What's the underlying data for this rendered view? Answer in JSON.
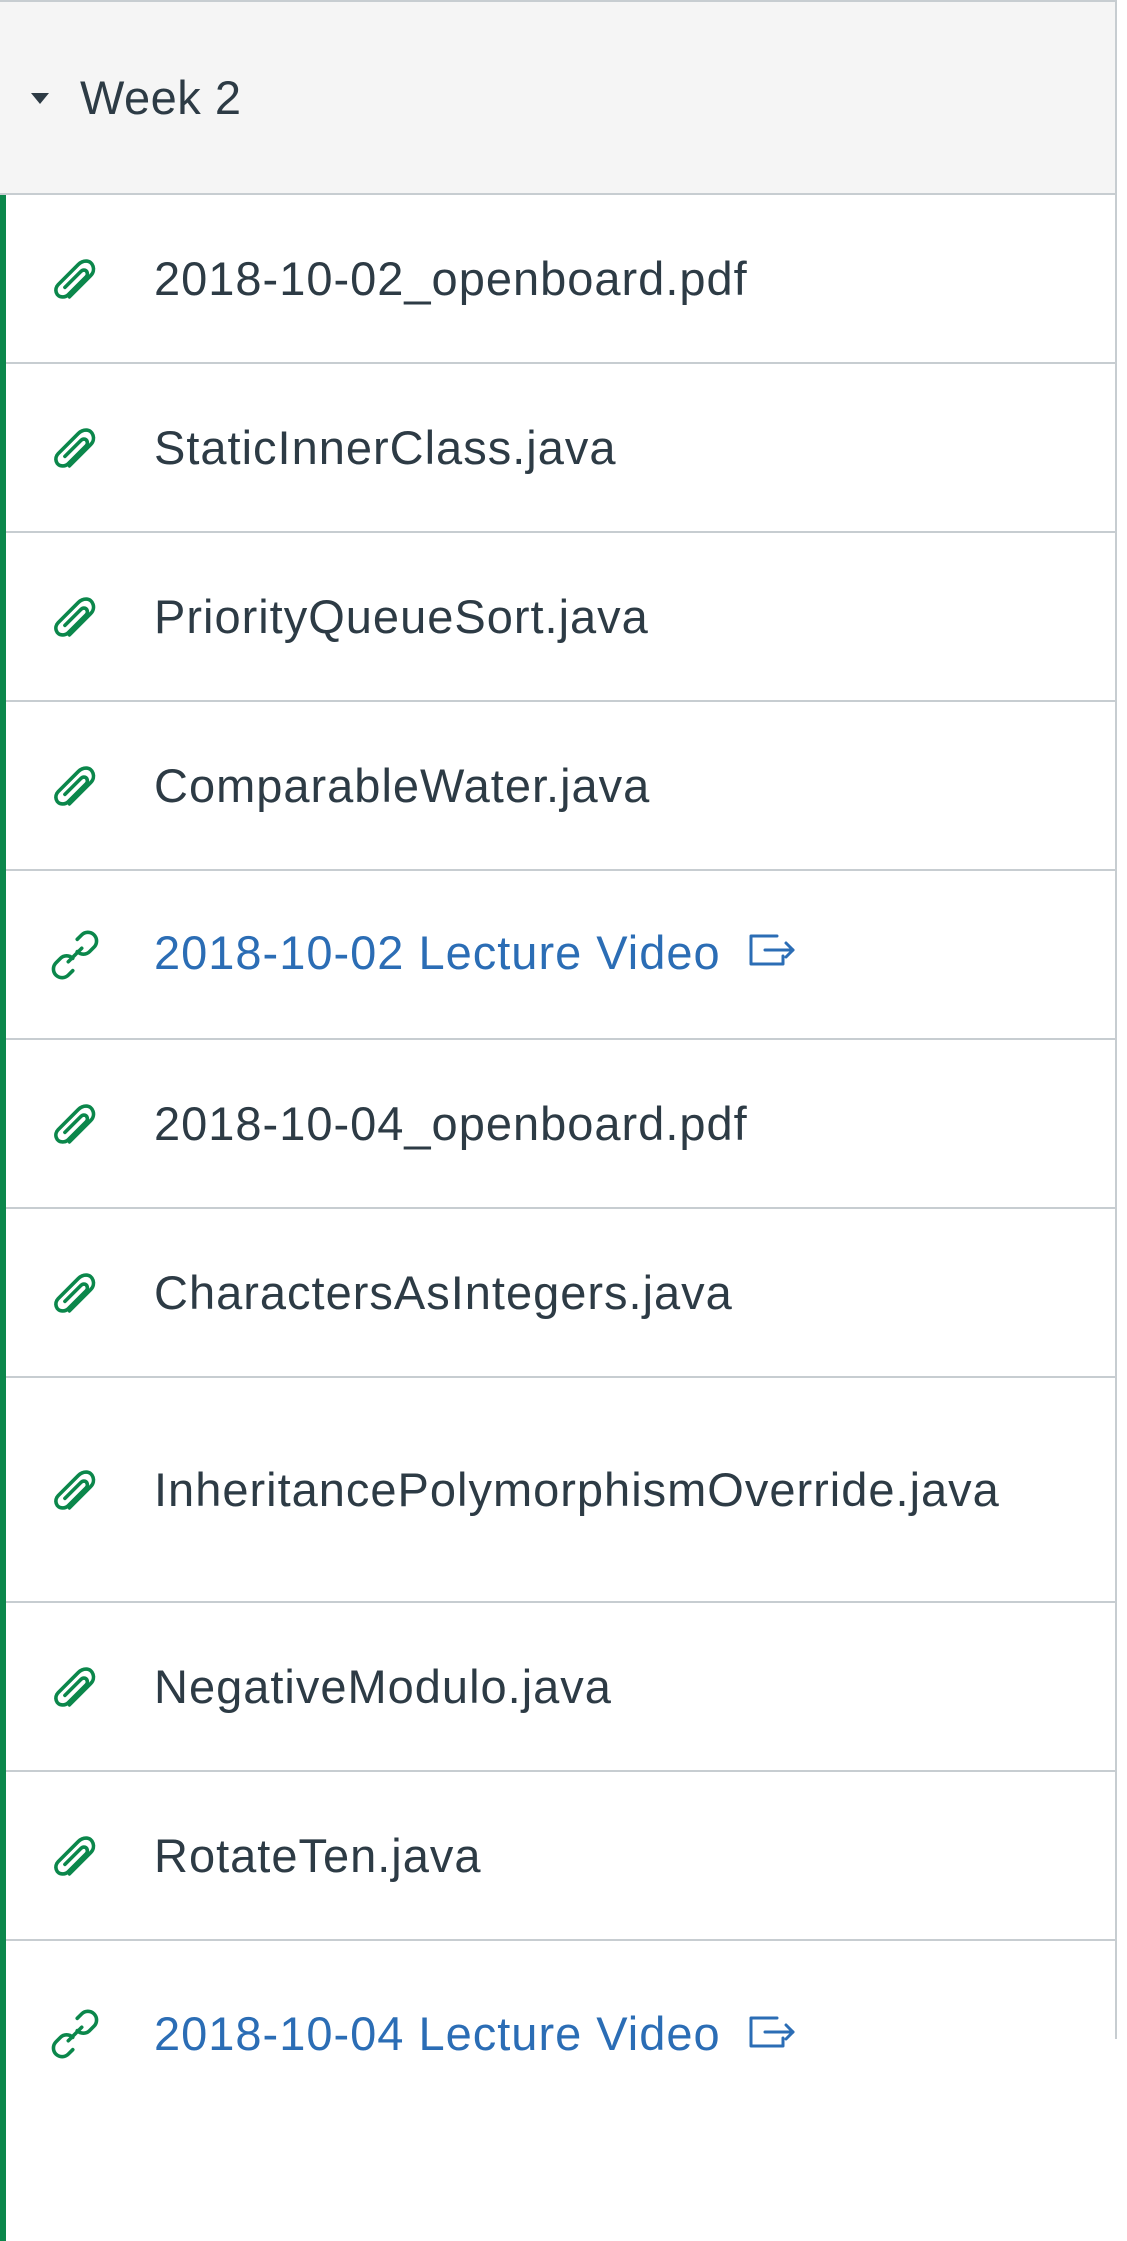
{
  "module": {
    "title": "Week 2",
    "accent_color": "#0b874b",
    "link_color": "#2b6db5",
    "text_color": "#2d3b45"
  },
  "items": [
    {
      "label": "2018-10-02_openboard.pdf",
      "icon": "paperclip-icon",
      "type": "attachment"
    },
    {
      "label": "StaticInnerClass.java",
      "icon": "paperclip-icon",
      "type": "attachment"
    },
    {
      "label": "PriorityQueueSort.java",
      "icon": "paperclip-icon",
      "type": "attachment"
    },
    {
      "label": "ComparableWater.java",
      "icon": "paperclip-icon",
      "type": "attachment"
    },
    {
      "label": "2018-10-02 Lecture Video",
      "icon": "link-icon",
      "type": "external-link",
      "trailing_icon": "external-link-icon"
    },
    {
      "label": "2018-10-04_openboard.pdf",
      "icon": "paperclip-icon",
      "type": "attachment"
    },
    {
      "label": "CharactersAsIntegers.java",
      "icon": "paperclip-icon",
      "type": "attachment"
    },
    {
      "label": "InheritancePolymorphismOverride.java",
      "icon": "paperclip-icon",
      "type": "attachment"
    },
    {
      "label": "NegativeModulo.java",
      "icon": "paperclip-icon",
      "type": "attachment"
    },
    {
      "label": "RotateTen.java",
      "icon": "paperclip-icon",
      "type": "attachment"
    },
    {
      "label": "2018-10-04 Lecture Video",
      "icon": "link-icon",
      "type": "external-link",
      "trailing_icon": "external-link-icon"
    }
  ]
}
